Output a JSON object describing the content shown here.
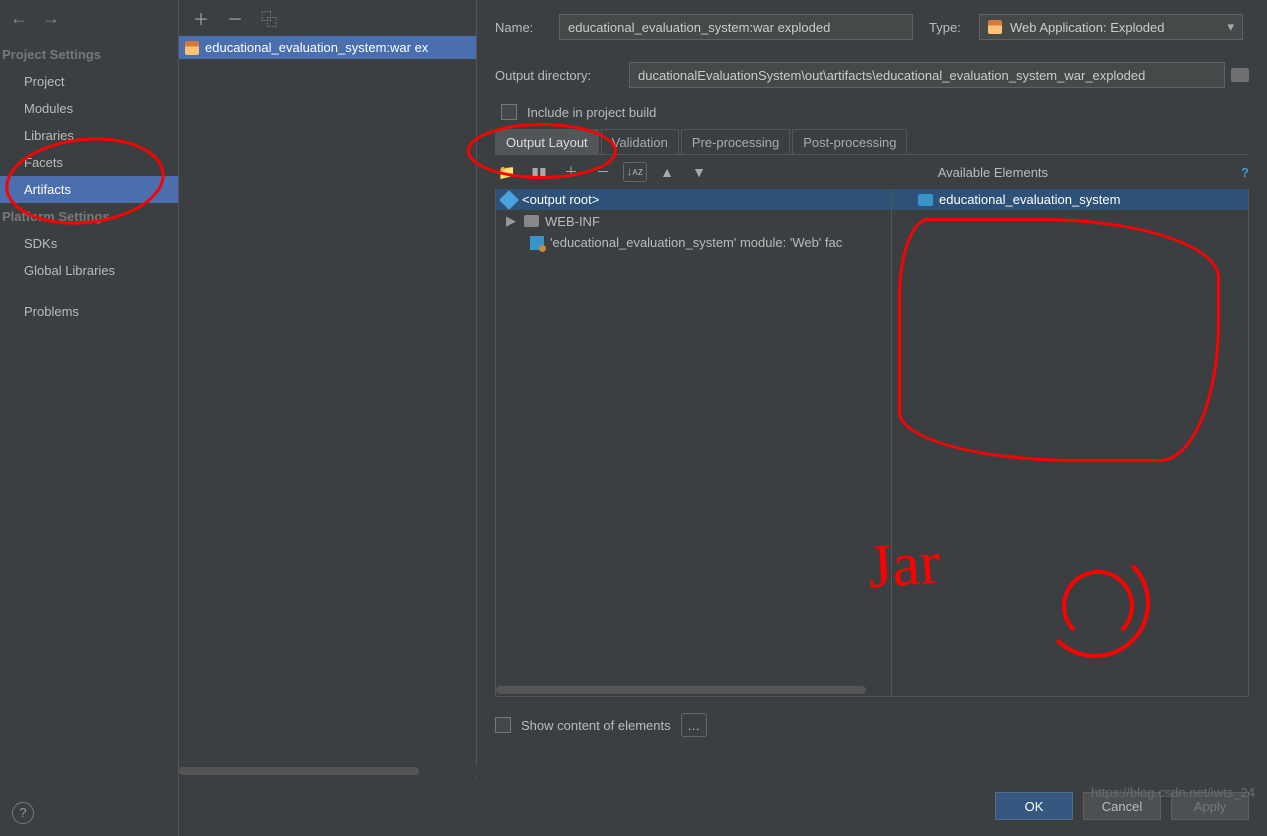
{
  "nav": {
    "heading_project": "Project Settings",
    "items_project": [
      "Project",
      "Modules",
      "Libraries",
      "Facets",
      "Artifacts"
    ],
    "selected_project": "Artifacts",
    "heading_platform": "Platform Settings",
    "items_platform": [
      "SDKs",
      "Global Libraries"
    ],
    "problems": "Problems"
  },
  "artifact_list": {
    "item": "educational_evaluation_system:war ex"
  },
  "form": {
    "name_label": "Name:",
    "name_value": "educational_evaluation_system:war exploded",
    "type_label": "Type:",
    "type_value": "Web Application: Exploded",
    "outdir_label": "Output directory:",
    "outdir_value": "ducationalEvaluationSystem\\out\\artifacts\\educational_evaluation_system_war_exploded",
    "include_label": "Include in project build"
  },
  "tabs": {
    "output_layout": "Output Layout",
    "validation": "Validation",
    "pre": "Pre-processing",
    "post": "Post-processing"
  },
  "toolbar": {
    "sort_label": "↓ᴀz",
    "avail_label": "Available Elements"
  },
  "left_tree": {
    "root": "<output root>",
    "webinf": "WEB-INF",
    "module": "'educational_evaluation_system' module: 'Web' fac"
  },
  "right_tree": {
    "root": "educational_evaluation_system"
  },
  "show_content": "Show content of elements",
  "buttons": {
    "ok": "OK",
    "cancel": "Cancel",
    "apply": "Apply"
  },
  "watermark": "https://blog.csdn.net/iwts_24"
}
